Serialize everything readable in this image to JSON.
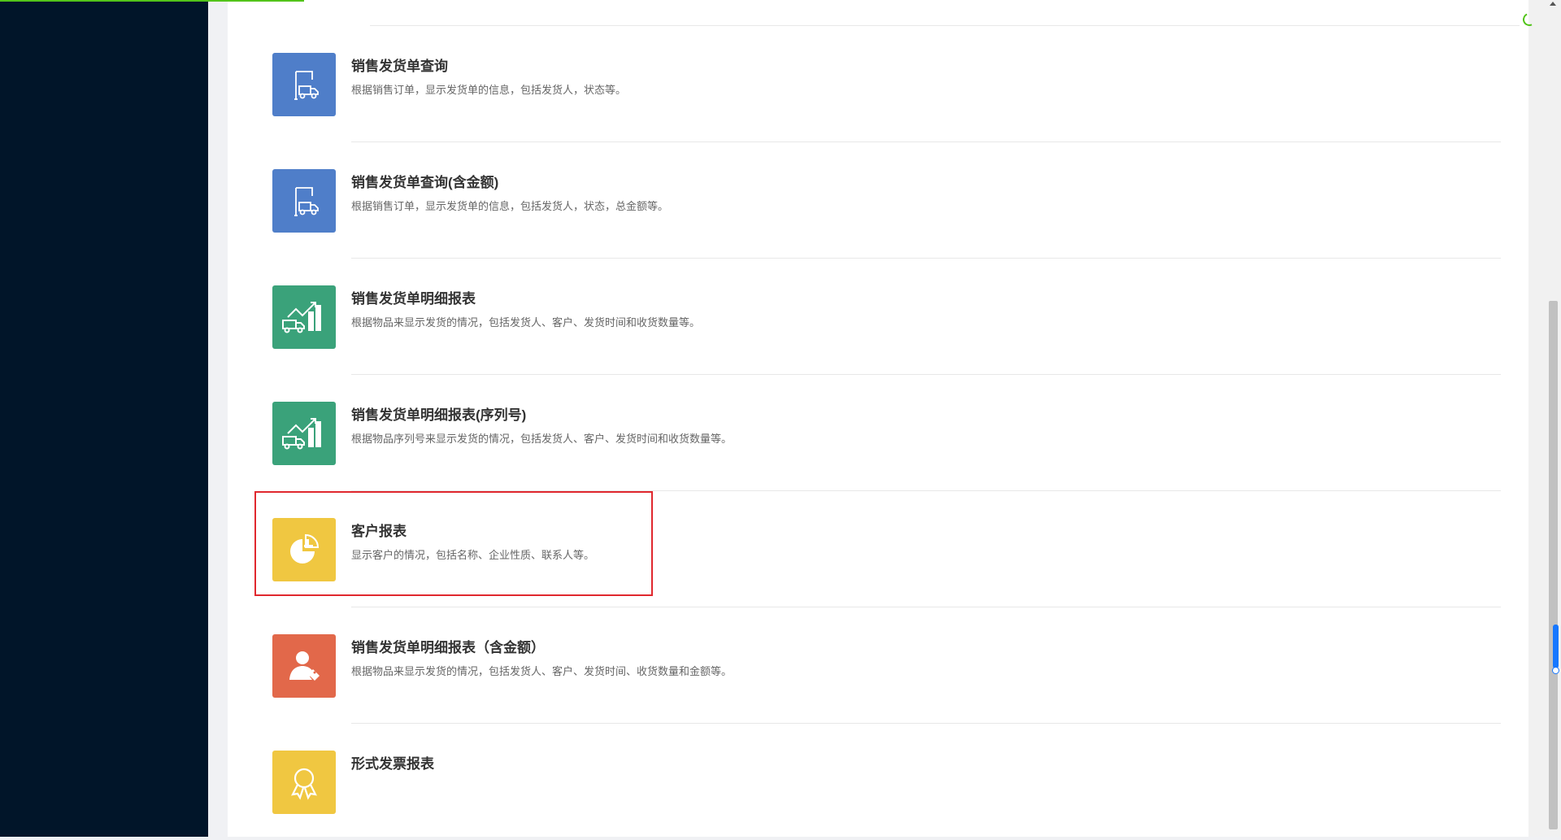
{
  "reports": [
    {
      "title": "销售发货单查询",
      "desc": "根据销售订单，显示发货单的信息，包括发货人，状态等。",
      "icon": "delivery-truck-icon",
      "color": "#4f7ec9"
    },
    {
      "title": "销售发货单查询(含金额)",
      "desc": "根据销售订单，显示发货单的信息，包括发货人，状态，总金额等。",
      "icon": "delivery-truck-icon",
      "color": "#4f7ec9"
    },
    {
      "title": "销售发货单明细报表",
      "desc": "根据物品来显示发货的情况，包括发货人、客户、发货时间和收货数量等。",
      "icon": "truck-growth-chart-icon",
      "color": "#3aa27a"
    },
    {
      "title": "销售发货单明细报表(序列号)",
      "desc": "根据物品序列号来显示发货的情况，包括发货人、客户、发货时间和收货数量等。",
      "icon": "truck-growth-chart-icon",
      "color": "#3aa27a"
    },
    {
      "title": "客户报表",
      "desc": "显示客户的情况，包括名称、企业性质、联系人等。",
      "icon": "pie-chart-icon",
      "color": "#f0c741"
    },
    {
      "title": "销售发货单明细报表（含金额）",
      "desc": "根据物品来显示发货的情况，包括发货人、客户、发货时间、收货数量和金额等。",
      "icon": "person-tag-icon",
      "color": "#e2684a"
    },
    {
      "title": "形式发票报表",
      "desc": "",
      "icon": "award-badge-icon",
      "color": "#f0c741"
    }
  ],
  "colors": {
    "sidebar_bg": "#011529",
    "progress": "#52c41a",
    "highlight_border": "#e0282e"
  }
}
